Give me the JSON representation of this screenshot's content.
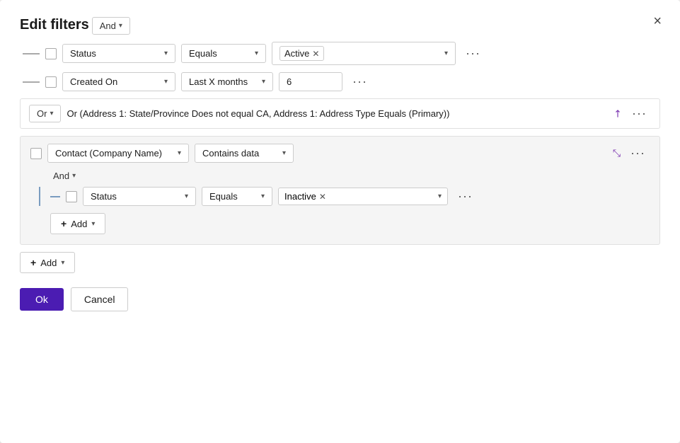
{
  "dialog": {
    "title": "Edit filters",
    "close_label": "×"
  },
  "top_logic": {
    "label": "And",
    "chevron": "▾"
  },
  "row1": {
    "field": "Status",
    "operator": "Equals",
    "value_chip": "Active",
    "more": "···"
  },
  "row2": {
    "field": "Created On",
    "operator": "Last X months",
    "value": "6",
    "more": "···"
  },
  "or_row": {
    "logic_label": "Or",
    "text": "Or (Address 1: State/Province Does not equal CA, Address 1: Address Type Equals (Primary))",
    "more": "···"
  },
  "nested_group": {
    "field": "Contact (Company Name)",
    "operator": "Contains data",
    "and_label": "And",
    "inner_row": {
      "field": "Status",
      "operator": "Equals",
      "value_chip": "Inactive",
      "more": "···"
    },
    "add_label": "Add",
    "more": "···"
  },
  "add_row": {
    "plus": "+",
    "label": "Add",
    "chevron": "▾"
  },
  "footer": {
    "ok_label": "Ok",
    "cancel_label": "Cancel"
  }
}
